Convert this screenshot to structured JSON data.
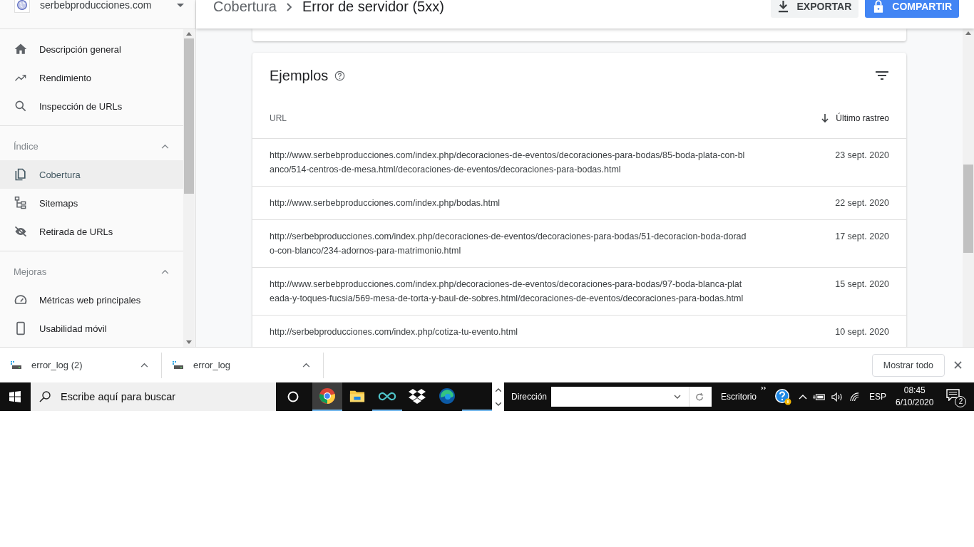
{
  "site_selector": {
    "label": "serbebproducciones.com"
  },
  "sidebar": {
    "groups": [
      {
        "items": [
          {
            "label": "Descripción general",
            "selected": false
          },
          {
            "label": "Rendimiento",
            "selected": false
          },
          {
            "label": "Inspección de URLs",
            "selected": false
          }
        ]
      },
      {
        "heading": "Índice",
        "expanded": true,
        "items": [
          {
            "label": "Cobertura",
            "selected": true
          },
          {
            "label": "Sitemaps",
            "selected": false
          },
          {
            "label": "Retirada de URLs",
            "selected": false
          }
        ]
      },
      {
        "heading": "Mejoras",
        "expanded": true,
        "items": [
          {
            "label": "Métricas web principales",
            "selected": false
          },
          {
            "label": "Usabilidad móvil",
            "selected": false
          }
        ]
      }
    ]
  },
  "breadcrumb": {
    "parent": "Cobertura",
    "current": "Error de servidor (5xx)"
  },
  "actions": {
    "export": "EXPORTAR",
    "share": "COMPARTIR"
  },
  "examples": {
    "title": "Ejemplos",
    "columns": [
      "URL",
      "Último rastreo"
    ],
    "rows": [
      {
        "url_lines": [
          "http://www.serbebproducciones.com/index.php/decoraciones-de-eventos/decoraciones-para-bodas/85-boda-plata-con-bl",
          "anco/514-centros-de-mesa.html/decoraciones-de-eventos/decoraciones-para-bodas.html"
        ],
        "date": "23 sept. 2020"
      },
      {
        "url_lines": [
          "http://www.serbebproducciones.com/index.php/bodas.html"
        ],
        "date": "22 sept. 2020"
      },
      {
        "url_lines": [
          "http://serbebproducciones.com/index.php/decoraciones-de-eventos/decoraciones-para-bodas/51-decoracion-boda-dorad",
          "o-con-blanco/234-adornos-para-matrimonio.html"
        ],
        "date": "17 sept. 2020"
      },
      {
        "url_lines": [
          "http://www.serbebproducciones.com/index.php/decoraciones-de-eventos/decoraciones-para-bodas/97-boda-blanca-plat",
          "eada-y-toques-fucsia/569-mesa-de-torta-y-baul-de-sobres.html/decoraciones-de-eventos/decoraciones-para-bodas.html"
        ],
        "date": "15 sept. 2020"
      },
      {
        "url_lines": [
          "http://serbebproducciones.com/index.php/cotiza-tu-evento.html"
        ],
        "date": "10 sept. 2020"
      }
    ]
  },
  "downloads": {
    "items": [
      {
        "name": "error_log (2)"
      },
      {
        "name": "error_log"
      }
    ],
    "show_all": "Mostrar todo"
  },
  "taskbar": {
    "search_placeholder": "Escribe aquí para buscar",
    "apps": [
      {
        "kind": "chrome",
        "selected": true
      },
      {
        "kind": "folder",
        "selected": false
      },
      {
        "kind": "infinity",
        "selected": false
      },
      {
        "kind": "dropbox",
        "selected": false
      },
      {
        "kind": "edge",
        "selected": false
      },
      {
        "kind": "blank",
        "selected": false
      }
    ],
    "address_label": "Dirección",
    "toolbar_label": "Escritorio",
    "language": "ESP",
    "time": "08:45",
    "date": "6/10/2020",
    "notification_count": "2"
  }
}
